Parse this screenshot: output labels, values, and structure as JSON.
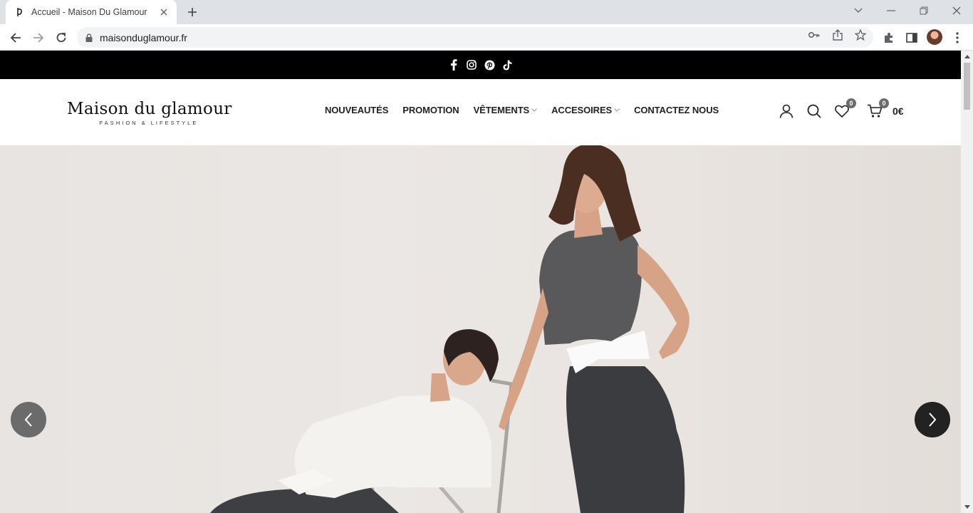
{
  "browser": {
    "tab_title": "Accueil - Maison Du Glamour",
    "url": "maisonduglamour.fr"
  },
  "site": {
    "logo_main": "Maison du glamour",
    "logo_sub": "FASHION & LIFESTYLE",
    "nav": [
      {
        "label": "NOUVEAUTÉS",
        "has_dropdown": false
      },
      {
        "label": "PROMOTION",
        "has_dropdown": false
      },
      {
        "label": "VÊTEMENTS",
        "has_dropdown": true
      },
      {
        "label": "ACCESOIRES",
        "has_dropdown": true
      },
      {
        "label": "CONTACTEZ NOUS",
        "has_dropdown": false
      }
    ],
    "wishlist_count": "0",
    "cart_count": "0",
    "cart_total": "0€",
    "social": [
      "facebook-icon",
      "instagram-icon",
      "pinterest-icon",
      "tiktok-icon"
    ]
  },
  "hero": {
    "prev_button_color": "#6b6b6b",
    "next_button_color": "#222222"
  },
  "colors": {
    "topbar": "#000000",
    "hero_background": "#e9e5e2"
  }
}
